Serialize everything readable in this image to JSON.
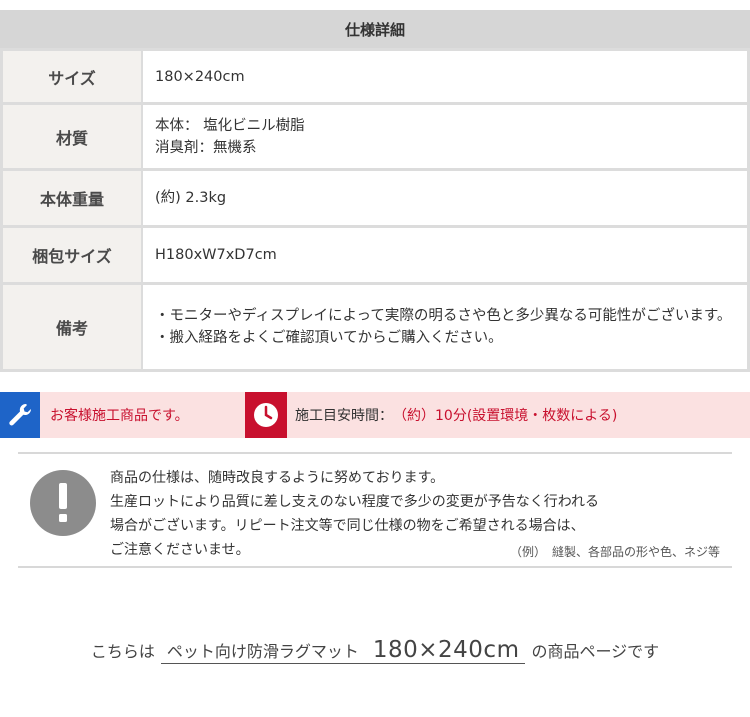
{
  "spec": {
    "title": "仕様詳細",
    "rows": [
      {
        "label": "サイズ",
        "lines": [
          "180×240cm"
        ]
      },
      {
        "label": "材質",
        "lines": [
          "本体： 塩化ビニル樹脂",
          "消臭剤：無機系"
        ]
      },
      {
        "label": "本体重量",
        "lines": [
          "(約) 2.3kg"
        ]
      },
      {
        "label": "梱包サイズ",
        "lines": [
          "H180xW7xD7cm"
        ]
      },
      {
        "label": "備考",
        "notes": [
          "・モニターやディスプレイによって実際の明るさや色と多少異なる可能性がございます。",
          "・搬入経路をよくご確認頂いてからご購入ください。"
        ]
      }
    ]
  },
  "band": {
    "install_text": "お客様施工商品です。",
    "time_label": "施工目安時間：",
    "time_value": "（約）10分(設置環境・枚数による)",
    "colors": {
      "blue": "#1e64c8",
      "red": "#c8102e",
      "band_bg": "#fbe1e1"
    },
    "icons": [
      "wrench-icon",
      "clock-icon"
    ]
  },
  "notice": {
    "icon": "exclamation-icon",
    "lines": [
      "商品の仕様は、随時改良するように努めております。",
      "生産ロットにより品質に差し支えのない程度で多少の変更が予告なく行われる",
      "場合がございます。リピート注文等で同じ仕様の物をご希望される場合は、",
      "ご注意くださいませ。"
    ],
    "example": "（例）　縫製、各部品の形や色、ネジ等"
  },
  "footer": {
    "prefix": "こちらは",
    "product_name": "ペット向け防滑ラグマット",
    "product_size": "180×240cm",
    "suffix": "の商品ページです"
  }
}
